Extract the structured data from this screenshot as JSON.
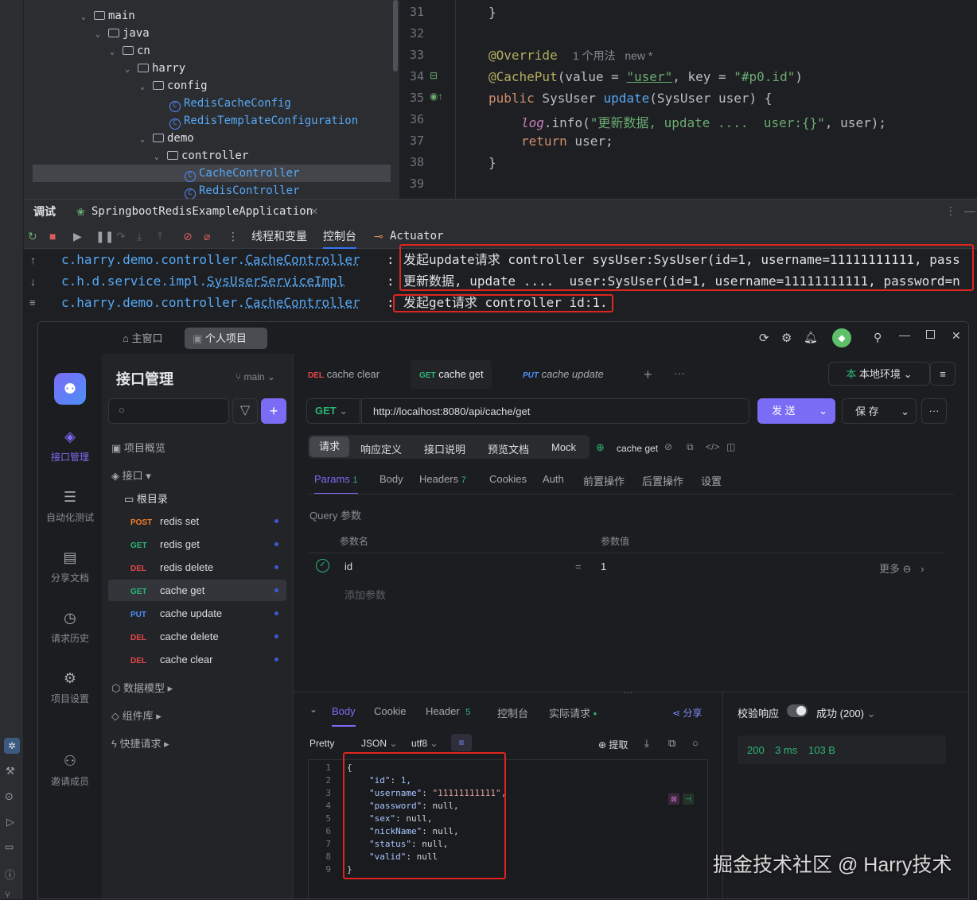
{
  "project_tree": {
    "items": [
      {
        "label": "main",
        "type": "folder"
      },
      {
        "label": "java",
        "type": "folder"
      },
      {
        "label": "cn",
        "type": "package"
      },
      {
        "label": "harry",
        "type": "package"
      },
      {
        "label": "config",
        "type": "package"
      },
      {
        "label": "RedisCacheConfig",
        "type": "class"
      },
      {
        "label": "RedisTemplateConfiguration",
        "type": "class"
      },
      {
        "label": "demo",
        "type": "package"
      },
      {
        "label": "controller",
        "type": "package"
      },
      {
        "label": "CacheController",
        "type": "class"
      },
      {
        "label": "RedisController",
        "type": "class"
      }
    ]
  },
  "editor": {
    "line_numbers": [
      "31",
      "32",
      "33",
      "34",
      "35",
      "36",
      "37",
      "38",
      "39"
    ],
    "l31": "}",
    "l33_ann": "@Override",
    "l33_hint": "1 个用法   new *",
    "l34_ann": "@CachePut",
    "l34_open": "(value = ",
    "l34_val": "\"user\"",
    "l34_mid": ", key = ",
    "l34_key": "\"#p0.id\"",
    "l34_close": ")",
    "l35_kw": "public",
    "l35_type": " SysUser ",
    "l35_fn": "update",
    "l35_rest": "(SysUser user) {",
    "l36_log": "log",
    "l36_info": ".info(",
    "l36_str": "\"更新数据, update ....  user:{}\"",
    "l36_rest": ", user);",
    "l37_kw": "return",
    "l37_rest": " user;",
    "l38": "}"
  },
  "debug": {
    "tab_debug": "调试",
    "tab_app": "SpringbootRedisExampleApplication",
    "toolbar": {
      "threads": "线程和变量",
      "console": "控制台",
      "actuator": "Actuator"
    },
    "logs": [
      {
        "src_pre": "c.harry.demo.controller.",
        "src_cls": "CacheController",
        "msg": "发起update请求 controller sysUser:SysUser(id=1, username=11111111111, pass"
      },
      {
        "src_pre": "c.h.d.service.impl.",
        "src_cls": "SysUserServiceImpl",
        "msg": "更新数据, update ....  user:SysUser(id=1, username=11111111111, password=n"
      },
      {
        "src_pre": "c.harry.demo.controller.",
        "src_cls": "CacheController",
        "msg": "发起get请求 controller id:1."
      }
    ]
  },
  "apifox": {
    "tabs": {
      "home": "主窗口",
      "project": "个人项目"
    },
    "nav": [
      {
        "label": "接口管理",
        "icon": "api-icon"
      },
      {
        "label": "自动化测试",
        "icon": "automation-icon"
      },
      {
        "label": "分享文档",
        "icon": "book-icon"
      },
      {
        "label": "请求历史",
        "icon": "clock-icon"
      },
      {
        "label": "项目设置",
        "icon": "gear-icon"
      },
      {
        "label": "邀请成员",
        "icon": "add-user-icon"
      }
    ],
    "sidebar": {
      "title": "接口管理",
      "branch": "main",
      "overview": "项目概览",
      "interfaces": "接口",
      "root": "根目录",
      "apis": [
        {
          "method": "POST",
          "name": "redis set"
        },
        {
          "method": "GET",
          "name": "redis get"
        },
        {
          "method": "DEL",
          "name": "redis delete"
        },
        {
          "method": "GET",
          "name": "cache get"
        },
        {
          "method": "PUT",
          "name": "cache update"
        },
        {
          "method": "DEL",
          "name": "cache delete"
        },
        {
          "method": "DEL",
          "name": "cache clear"
        }
      ],
      "models": "数据模型",
      "components": "组件库",
      "quick": "快捷请求"
    },
    "req_tabs": [
      {
        "method": "DEL",
        "name": "cache clear"
      },
      {
        "method": "GET",
        "name": "cache get"
      },
      {
        "method": "PUT",
        "name": "cache update"
      }
    ],
    "env": "本地环境",
    "request": {
      "method": "GET",
      "url": "http://localhost:8080/api/cache/get",
      "send": "发 送",
      "save": "保 存"
    },
    "sections": {
      "req": "请求",
      "resp_def": "响应定义",
      "doc": "接口说明",
      "preview": "预览文档",
      "mock": "Mock",
      "api_name": "cache get"
    },
    "param_tabs": {
      "params": "Params",
      "params_count": "1",
      "body": "Body",
      "headers": "Headers",
      "headers_count": "7",
      "cookies": "Cookies",
      "auth": "Auth",
      "pre": "前置操作",
      "post": "后置操作",
      "settings": "设置"
    },
    "query": {
      "title": "Query 参数",
      "col_name": "参数名",
      "col_value": "参数值",
      "name": "id",
      "eq": "=",
      "value": "1",
      "more": "更多",
      "add": "添加参数"
    },
    "response": {
      "tabs": {
        "body": "Body",
        "cookie": "Cookie",
        "header": "Header",
        "header_count": "5",
        "console": "控制台",
        "actual": "实际请求",
        "share": "分享"
      },
      "format": {
        "pretty": "Pretty",
        "json": "JSON",
        "encoding": "utf8",
        "extract": "提取"
      },
      "validate": "校验响应",
      "status_text": "成功 (200)",
      "status_code": "200",
      "time": "3 ms",
      "size": "103 B",
      "json_lines": [
        "1",
        "2",
        "3",
        "4",
        "5",
        "6",
        "7",
        "8",
        "9"
      ],
      "json": [
        {
          "k": "",
          "v": "{",
          "t": "brace"
        },
        {
          "k": "\"id\"",
          "v": "1,",
          "t": "num"
        },
        {
          "k": "\"username\"",
          "v": "\"11111111111\",",
          "t": "str"
        },
        {
          "k": "\"password\"",
          "v": "null,",
          "t": "null"
        },
        {
          "k": "\"sex\"",
          "v": "null,",
          "t": "null"
        },
        {
          "k": "\"nickName\"",
          "v": "null,",
          "t": "null"
        },
        {
          "k": "\"status\"",
          "v": "null,",
          "t": "null"
        },
        {
          "k": "\"valid\"",
          "v": "null",
          "t": "null"
        },
        {
          "k": "",
          "v": "}",
          "t": "brace"
        }
      ]
    }
  },
  "watermark": "掘金技术社区 @ Harry技术",
  "colors": {
    "highlight_box": "#e0251f",
    "accent": "#7b6cf6",
    "get": "#2bb673",
    "del": "#e84749",
    "put": "#4d8ef7",
    "post": "#f57c2e"
  }
}
